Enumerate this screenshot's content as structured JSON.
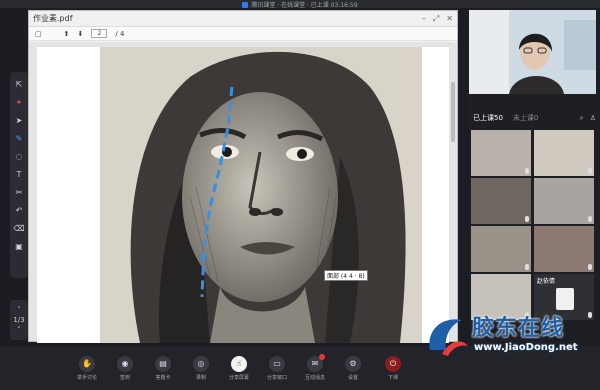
{
  "window": {
    "title": "腾讯课堂 · 在线课堂 · 已上课 03:16:59"
  },
  "doc": {
    "filename": "作业素.pdf",
    "page_current": "2",
    "page_total": "/ 4",
    "annotation": "面部 (4 4 · 8)"
  },
  "pager": {
    "text": "1/3"
  },
  "right_panel": {
    "tab_in_class": "已上课50",
    "tab_not_in": "未上课0",
    "student_named": "赵依倩"
  },
  "bottom_bar": {
    "items": [
      {
        "label": "举手讨论",
        "icon": "hand-icon"
      },
      {
        "label": "签到",
        "icon": "location-icon"
      },
      {
        "label": "答题卡",
        "icon": "card-icon"
      },
      {
        "label": "录制",
        "icon": "record-icon"
      },
      {
        "label": "分享屏幕",
        "icon": "share-screen-icon"
      },
      {
        "label": "分享窗口",
        "icon": "window-icon"
      },
      {
        "label": "互动消息",
        "icon": "chat-icon"
      },
      {
        "label": "设置",
        "icon": "settings-icon"
      },
      {
        "label": "下课",
        "icon": "power-icon"
      }
    ]
  },
  "watermark": {
    "title": "胶东在线",
    "url": "www.JiaoDong.net"
  },
  "colors": {
    "accent": "#1f5fa8",
    "annotation_line": "#3a8fe0",
    "end_class": "#8a1d1d"
  }
}
